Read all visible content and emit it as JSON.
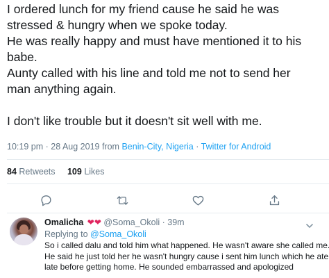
{
  "tweet": {
    "lines": [
      "I ordered lunch for my friend cause he said he was",
      "stressed & hungry when we spoke today.",
      "He was really happy and must have mentioned it to his",
      "babe.",
      "Aunty called with his line and told me not to send her",
      "man anything again.",
      "",
      "I don't like trouble but it doesn't sit well with me."
    ],
    "time": "10:19 pm",
    "date": "28 Aug 2019",
    "from_label": "from",
    "location": "Benin-City, Nigeria",
    "source": "Twitter for Android",
    "separator": "·"
  },
  "stats": {
    "retweets_count": "84",
    "retweets_label": "Retweets",
    "likes_count": "109",
    "likes_label": "Likes"
  },
  "actions": {
    "icons": [
      "reply-icon",
      "retweet-icon",
      "like-icon",
      "share-icon"
    ]
  },
  "reply": {
    "name": "Omalicha",
    "hearts": "❤❤",
    "handle": "@Soma_Okoli",
    "separator": "·",
    "age": "39m",
    "replying_prefix": "Replying to",
    "replying_to": "@Soma_Okoli",
    "text_lines": [
      "So i called dalu and told him what happened. He wasn't aware she called me.",
      "He said he just told her he wasn't hungry cause i sent him lunch which he ate",
      "late before getting home. He sounded embarrassed and apologized"
    ]
  },
  "colors": {
    "text": "#14171a",
    "muted": "#657786",
    "link": "#1da1f2",
    "heart": "#e0245e",
    "divider": "#e6ecf0"
  }
}
